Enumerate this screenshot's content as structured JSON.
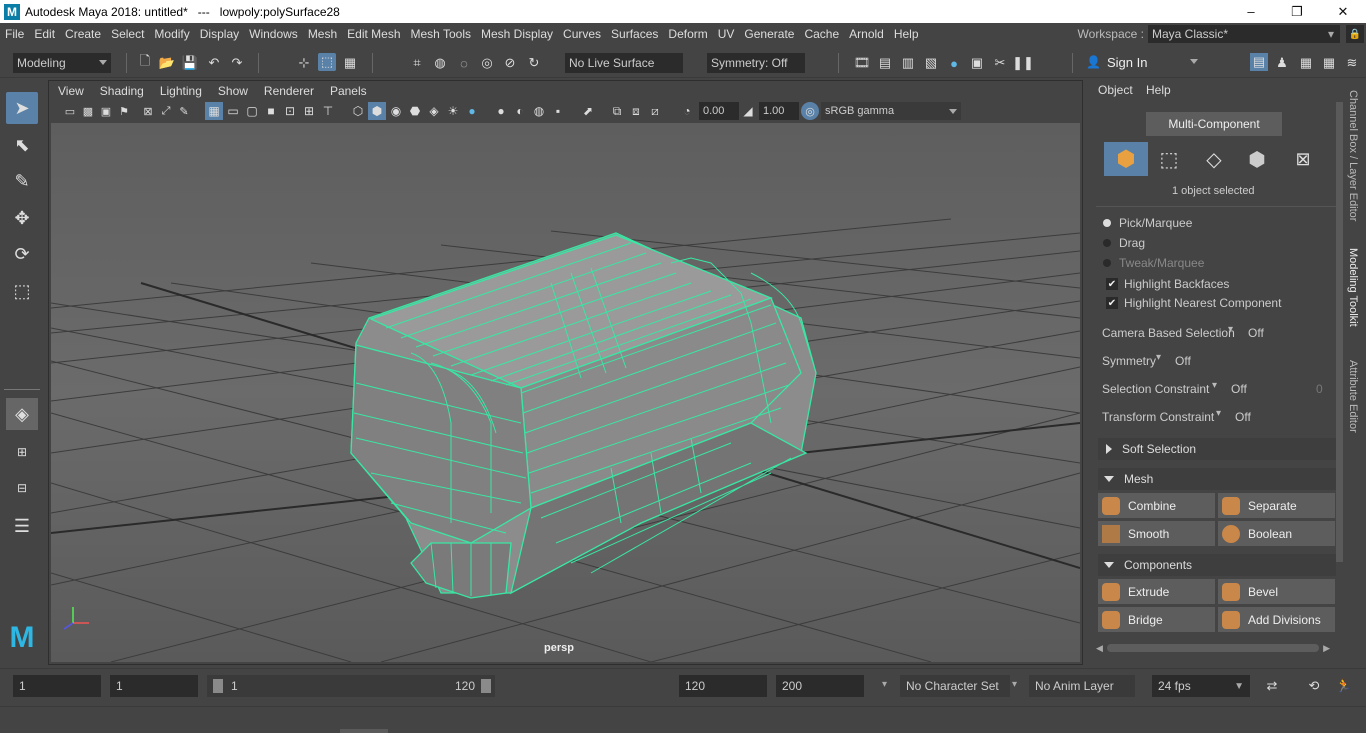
{
  "window": {
    "app_title": "Autodesk Maya 2018: untitled*",
    "separator": "---",
    "object_title": "lowpoly:polySurface28",
    "minimize": "–",
    "maximize": "❐",
    "close": "✕"
  },
  "menubar": {
    "items": [
      "File",
      "Edit",
      "Create",
      "Select",
      "Modify",
      "Display",
      "Windows",
      "Mesh",
      "Edit Mesh",
      "Mesh Tools",
      "Mesh Display",
      "Curves",
      "Surfaces",
      "Deform",
      "UV",
      "Generate",
      "Cache",
      "Arnold",
      "Help"
    ],
    "workspace_label": "Workspace :",
    "workspace_value": "Maya Classic*"
  },
  "statusline": {
    "menuset": "Modeling",
    "live_surface": "No Live Surface",
    "symmetry": "Symmetry: Off",
    "sign_in": "Sign In"
  },
  "viewport": {
    "menus": [
      "View",
      "Shading",
      "Lighting",
      "Show",
      "Renderer",
      "Panels"
    ],
    "exposure": "0.00",
    "gamma": "1.00",
    "color_space": "sRGB gamma",
    "camera_label": "persp"
  },
  "modeling_toolkit": {
    "menus": [
      "Object",
      "Help"
    ],
    "mode_button": "Multi-Component",
    "selection_status": "1 object selected",
    "pick_options": [
      "Pick/Marquee",
      "Drag",
      "Tweak/Marquee"
    ],
    "highlight_backfaces": "Highlight Backfaces",
    "highlight_nearest": "Highlight Nearest Component",
    "camera_based_label": "Camera Based Selection",
    "camera_based_value": "Off",
    "symmetry_label": "Symmetry",
    "symmetry_value": "Off",
    "selection_constraint_label": "Selection Constraint",
    "selection_constraint_value": "Off",
    "selection_constraint_num": "0",
    "transform_constraint_label": "Transform Constraint",
    "transform_constraint_value": "Off",
    "soft_selection": "Soft Selection",
    "mesh_section": "Mesh",
    "combine": "Combine",
    "separate": "Separate",
    "smooth": "Smooth",
    "boolean": "Boolean",
    "components_section": "Components",
    "extrude": "Extrude",
    "bevel": "Bevel",
    "bridge": "Bridge",
    "add_divisions": "Add Divisions"
  },
  "side_tabs": [
    "Channel Box / Layer Editor",
    "Modeling Toolkit",
    "Attribute Editor"
  ],
  "range": {
    "start": "1",
    "current": "1",
    "slider_start": "1",
    "slider_end": "120",
    "end": "120",
    "anim_end": "200",
    "character_set": "No Character Set",
    "anim_layer": "No Anim Layer",
    "fps": "24 fps"
  },
  "colors": {
    "wireframe": "#39e7a4",
    "mesh_fill": "#8c8c8c",
    "active_icon": "#5a82a8"
  }
}
